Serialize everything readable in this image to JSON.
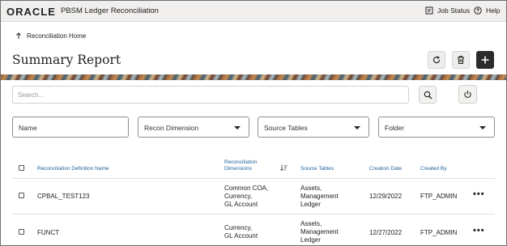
{
  "header": {
    "logo": "ORACLE",
    "app_title": "PBSM Ledger Reconciliation",
    "job_status_label": "Job Status",
    "help_label": "Help"
  },
  "breadcrumb": {
    "label": "Reconciliation Home"
  },
  "page": {
    "title": "Summary Report"
  },
  "search": {
    "placeholder": "Search..."
  },
  "filters": [
    {
      "label": "Name",
      "has_dropdown": false
    },
    {
      "label": "Recon Dimension",
      "has_dropdown": true
    },
    {
      "label": "Source Tables",
      "has_dropdown": true
    },
    {
      "label": "Folder",
      "has_dropdown": true
    }
  ],
  "table": {
    "columns": {
      "name": "Reconciliation Definition Name",
      "dims_line1": "Reconciliation",
      "dims_line2": "Dimensions",
      "source": "Source Tables",
      "date": "Creation Date",
      "created_by": "Created By"
    },
    "rows": [
      {
        "name": "CPBAL_TEST123",
        "dims": [
          "Common COA,",
          "Currency,",
          "GL Account"
        ],
        "source": [
          "Assets,",
          "Management",
          "Ledger"
        ],
        "date": "12/29/2022",
        "created_by": "FTP_ADMIN"
      },
      {
        "name": "FUNCT",
        "dims": [
          "Currency,",
          "GL Account"
        ],
        "source": [
          "Assets,",
          "Management",
          "Ledger"
        ],
        "date": "12/27/2022",
        "created_by": "FTP_ADMIN"
      }
    ]
  },
  "icons": [
    "job-status-icon",
    "help-icon",
    "refresh-icon",
    "delete-icon",
    "add-icon",
    "search-icon",
    "power-icon",
    "sort-icon",
    "more-icon"
  ]
}
